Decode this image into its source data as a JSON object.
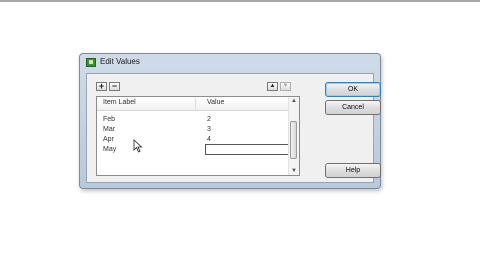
{
  "dialog": {
    "title": "Edit Values",
    "icon": "table-app-icon"
  },
  "toolbar": {
    "add_symbol": "+",
    "remove_symbol": "−",
    "move_up_symbol": "▲",
    "move_down_symbol": "▼"
  },
  "list": {
    "columns": [
      "Item Label",
      "Value"
    ],
    "rows": [
      {
        "label": "Feb",
        "value": "2"
      },
      {
        "label": "Mar",
        "value": "3"
      },
      {
        "label": "Apr",
        "value": "4"
      },
      {
        "label": "May",
        "value": ""
      }
    ]
  },
  "buttons": {
    "ok": "OK",
    "cancel": "Cancel",
    "help": "Help"
  }
}
